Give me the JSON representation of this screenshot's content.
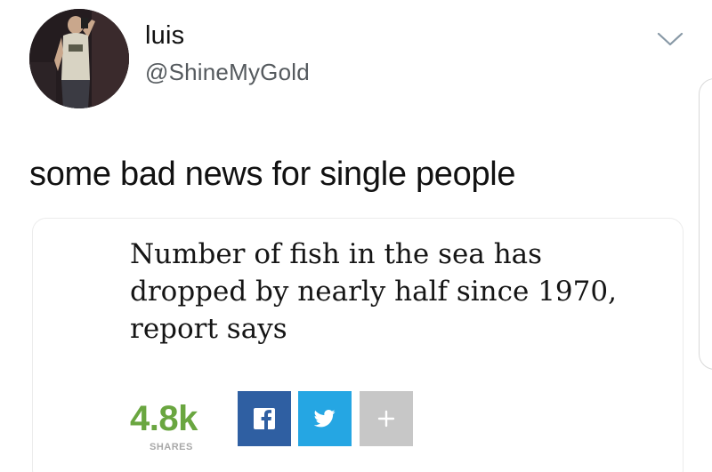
{
  "tweet": {
    "author_name": "luis",
    "author_handle": "@ShineMyGold",
    "text": "some bad news for single people",
    "menu_icon": "chevron-down-icon"
  },
  "card": {
    "headline": "Number of fish in the sea has dropped by nearly half since 1970, report says",
    "share_count": "4.8k",
    "share_label": "SHARES",
    "buttons": [
      {
        "name": "facebook",
        "icon": "facebook-icon",
        "color": "#2f5fa2"
      },
      {
        "name": "twitter",
        "icon": "twitter-bird-icon",
        "color": "#25a6e3"
      },
      {
        "name": "more",
        "icon": "plus-icon",
        "color": "#c7c7c7"
      }
    ],
    "share_count_color": "#6aa640"
  }
}
